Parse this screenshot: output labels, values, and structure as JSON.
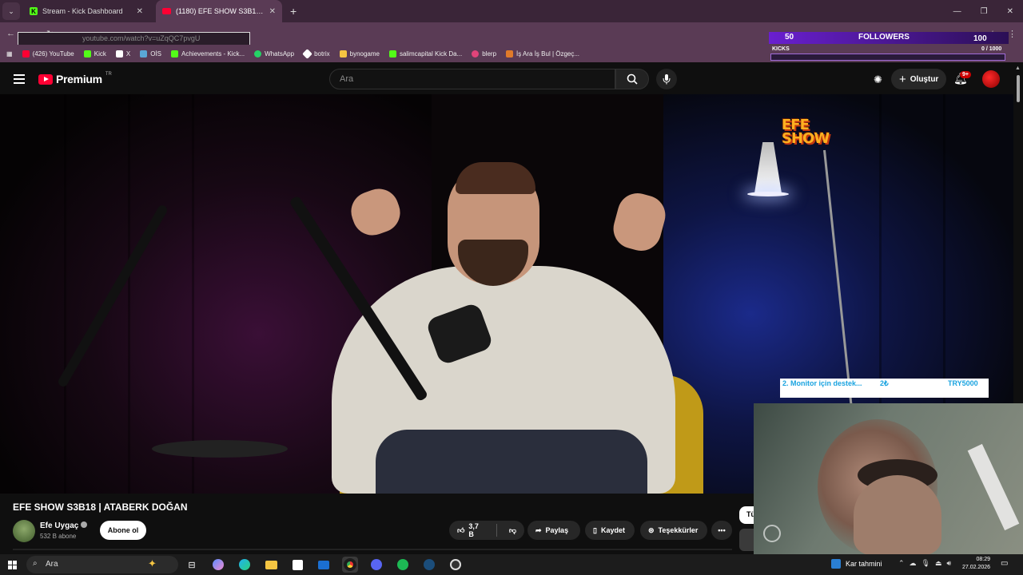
{
  "browser": {
    "tabs": [
      {
        "label": "Stream - Kick Dashboard",
        "active": false
      },
      {
        "label": "(1180) EFE SHOW S3B18 | ATAB",
        "active": true
      }
    ],
    "url": "youtube.com/watch?v=uZqQC7pvgU",
    "bookmarks": [
      {
        "label": "(426) YouTube",
        "color": "#ff0033"
      },
      {
        "label": "Kick",
        "color": "#53fc18"
      },
      {
        "label": "X",
        "color": "#ffffff"
      },
      {
        "label": "OİS",
        "color": "#5aa7d6"
      },
      {
        "label": "Achievements - Kick...",
        "color": "#53fc18"
      },
      {
        "label": "WhatsApp",
        "color": "#25d366"
      },
      {
        "label": "botrix",
        "color": "#ffffff"
      },
      {
        "label": "bynogame",
        "color": "#f5c542"
      },
      {
        "label": "salimcapital Kick Da...",
        "color": "#53fc18"
      },
      {
        "label": "blerp",
        "color": "#e0447a"
      },
      {
        "label": "İş Ara İş Bul | Özgeç...",
        "color": "#e07a2a"
      }
    ]
  },
  "overlay": {
    "followers_current": "50",
    "followers_title": "FOLLOWERS",
    "followers_goal": "100",
    "followers_progress": 0.5,
    "kicks_label": "KICKS",
    "kicks_count": "0 / 1000",
    "donation_message": "2. Monitor için destek...",
    "donation_amount": "2₺",
    "donation_currency": "TRY5000"
  },
  "youtube": {
    "brand": "Premium",
    "region": "TR",
    "search_placeholder": "Ara",
    "create_label": "Oluştur",
    "notifications": "9+",
    "show_logo": "EFE SHOW",
    "video_title": "EFE SHOW S3B18 | ATABERK DOĞAN",
    "channel_name": "Efe Uygaç",
    "subscribers": "532 B abone",
    "subscribe_label": "Abone ol",
    "likes": "3,7 B",
    "share_label": "Paylaş",
    "save_label": "Kaydet",
    "thanks_label": "Teşekkürler",
    "side_chip": "Tü"
  },
  "taskbar": {
    "search_label": "Ara",
    "weather": "Kar tahmini",
    "time": "08:29",
    "date": "27.02.2026"
  }
}
